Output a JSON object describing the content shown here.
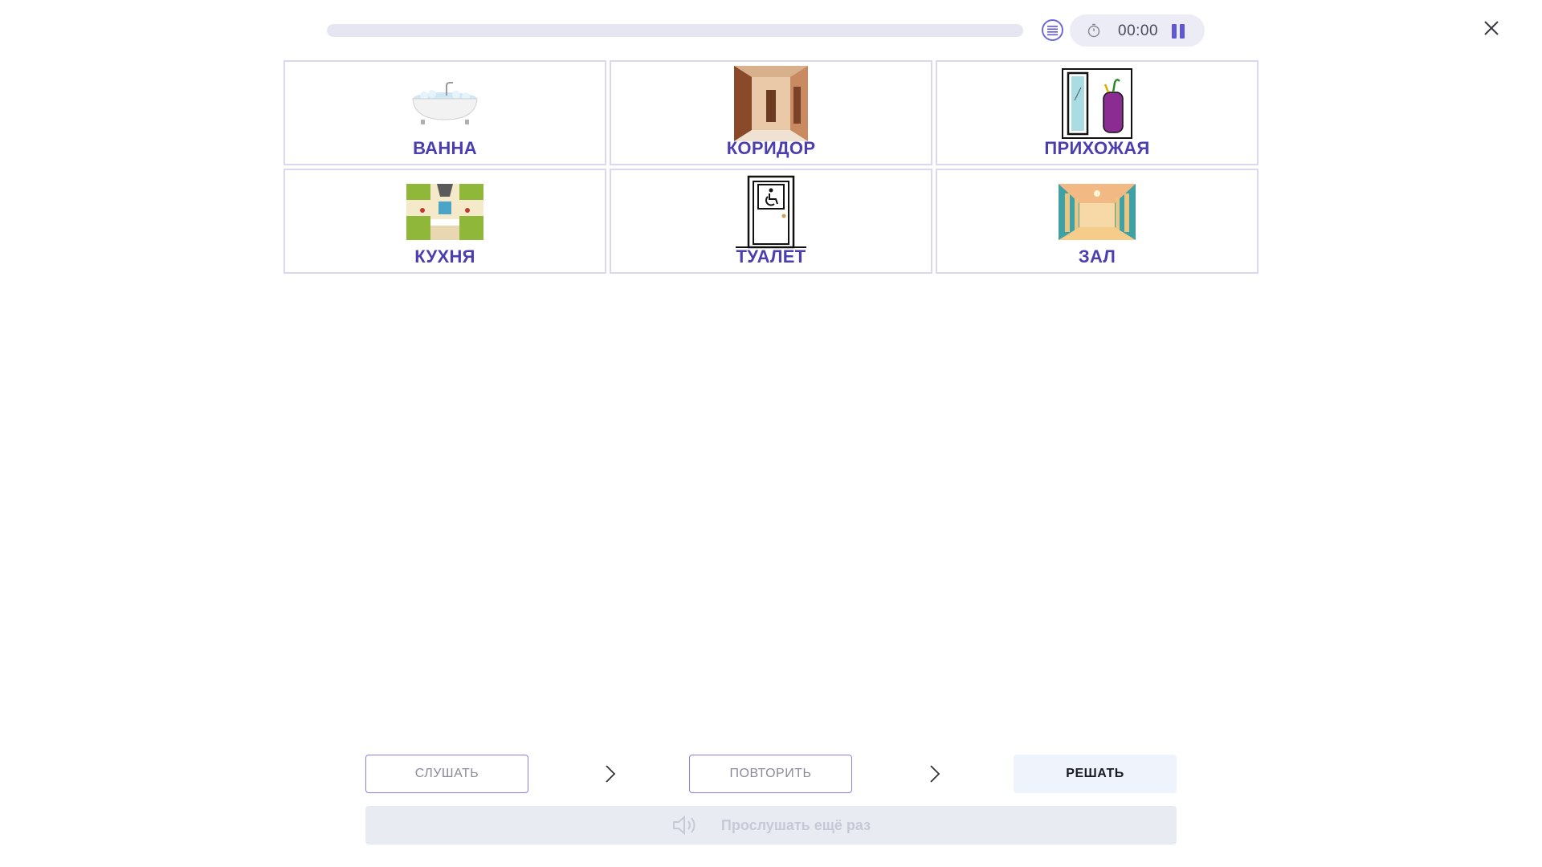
{
  "header": {
    "progress": 0,
    "timer": "00:00"
  },
  "cards": [
    {
      "label": "ВАННА",
      "icon": "bathtub-image"
    },
    {
      "label": "КОРИДОР",
      "icon": "corridor-image"
    },
    {
      "label": "ПРИХОЖАЯ",
      "icon": "hallway-image"
    },
    {
      "label": "КУХНЯ",
      "icon": "kitchen-image"
    },
    {
      "label": "ТУАЛЕТ",
      "icon": "toilet-door-image"
    },
    {
      "label": "ЗАЛ",
      "icon": "hall-image"
    }
  ],
  "controls": {
    "listen_label": "СЛУШАТЬ",
    "repeat_label": "ПОВТОРИТЬ",
    "solve_label": "РЕШАТЬ",
    "listen_again_label": "Прослушать ещё раз"
  },
  "colors": {
    "accent": "#5f57d6",
    "label": "#4b3fb0",
    "card_border": "#d9d8f0"
  }
}
